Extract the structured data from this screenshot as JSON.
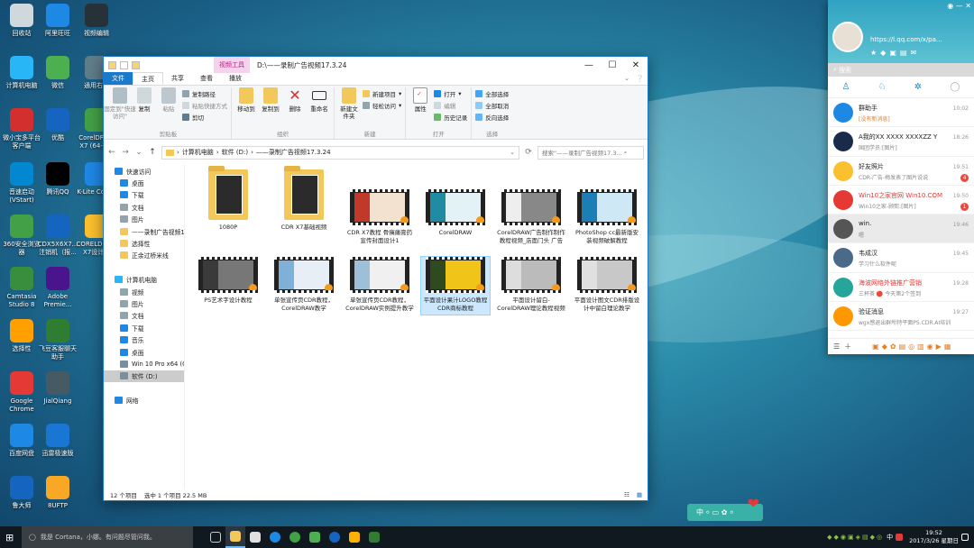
{
  "desktop_icons": [
    {
      "label": "回收站",
      "color": "#cfd8dc"
    },
    {
      "label": "阿里旺旺",
      "color": "#1e88e5"
    },
    {
      "label": "视频编辑",
      "color": "#263238"
    },
    {
      "label": "计算机电脑",
      "color": "#29b6f6"
    },
    {
      "label": "微信",
      "color": "#4caf50"
    },
    {
      "label": "通用右下",
      "color": "#607d8b"
    },
    {
      "label": "微小宝多平台客户端",
      "color": "#d32f2f"
    },
    {
      "label": "优酷",
      "color": "#1565c0"
    },
    {
      "label": "CorelDRAW X7 (64-Bit)",
      "color": "#43a047"
    },
    {
      "label": "音速启动(VStart)",
      "color": "#0288d1"
    },
    {
      "label": "腾讯QQ",
      "color": "#000"
    },
    {
      "label": "K-Lite Codec",
      "color": "#1e88e5"
    },
    {
      "label": "360安全浏览器",
      "color": "#43a047"
    },
    {
      "label": "CDX5X6X7...注销机（报...",
      "color": "#1565c0"
    },
    {
      "label": "CORELDRAW X7设计...",
      "color": "#fbc02d"
    },
    {
      "label": "Camtasia Studio 8",
      "color": "#388e3c"
    },
    {
      "label": "Adobe Premie...",
      "color": "#4a148c"
    },
    {
      "label": "选择性",
      "color": "#ffa000"
    },
    {
      "label": "飞豆客服聊天助手",
      "color": "#2e7d32"
    },
    {
      "label": "Google Chrome",
      "color": "#e53935"
    },
    {
      "label": "JialQiang",
      "color": "#455a64"
    },
    {
      "label": "百度网盘",
      "color": "#1e88e5"
    },
    {
      "label": "迅雷极速版",
      "color": "#1976d2"
    },
    {
      "label": "鲁大师",
      "color": "#1565c0"
    },
    {
      "label": "8UFTP",
      "color": "#f9a825"
    }
  ],
  "explorer": {
    "quick_access_toolbar": "",
    "context_tab": "视频工具",
    "title": "D:\\——录制广告视频17.3.24",
    "buttons": {
      "minimize": "—",
      "maximize": "☐",
      "close": "✕"
    },
    "tabs": [
      "文件",
      "主页",
      "共享",
      "查看",
      "播放"
    ],
    "ribbon": {
      "clipboard": {
        "name": "剪贴板",
        "pin": "固定到\"快速访问\"",
        "copy": "复制",
        "paste": "粘贴",
        "cut": "剪切",
        "copy_path": "复制路径",
        "paste_shortcut": "粘贴快捷方式"
      },
      "organize": {
        "name": "组织",
        "move_to": "移动到",
        "copy_to": "复制到",
        "delete": "删除",
        "rename": "重命名"
      },
      "new": {
        "name": "新建",
        "new_folder": "新建文件夹",
        "new_item": "新建项目",
        "easy_access": "轻松访问"
      },
      "open": {
        "name": "打开",
        "properties": "属性",
        "open": "打开",
        "edit": "编辑",
        "history": "历史记录"
      },
      "select": {
        "name": "选择",
        "select_all": "全部选择",
        "select_none": "全部取消",
        "invert": "反向选择"
      }
    },
    "address_path": [
      "计算机电脑",
      "软件 (D:)",
      "——录制广告视频17.3.24"
    ],
    "search_placeholder": "搜索\"——录制广告视频17.3...",
    "nav": [
      {
        "label": "快速访问",
        "icon": "star",
        "color": "#1e88e5",
        "indent": 0
      },
      {
        "label": "桌面",
        "icon": "desktop",
        "color": "#1e88e5",
        "indent": 1
      },
      {
        "label": "下载",
        "icon": "download",
        "color": "#1e88e5",
        "indent": 1
      },
      {
        "label": "文档",
        "icon": "doc",
        "color": "#90a4ae",
        "indent": 1
      },
      {
        "label": "图片",
        "icon": "pic",
        "color": "#90a4ae",
        "indent": 1
      },
      {
        "label": "——录制广告视频1",
        "icon": "folder",
        "color": "#f3c85b",
        "indent": 1
      },
      {
        "label": "选择性",
        "icon": "folder",
        "color": "#f3c85b",
        "indent": 1
      },
      {
        "label": "正余过桥米线",
        "icon": "folder",
        "color": "#f3c85b",
        "indent": 1
      },
      {
        "label": "",
        "icon": "",
        "color": "",
        "indent": 0
      },
      {
        "label": "计算机电脑",
        "icon": "pc",
        "color": "#29b6f6",
        "indent": 0
      },
      {
        "label": "视频",
        "icon": "video",
        "color": "#90a4ae",
        "indent": 1
      },
      {
        "label": "图片",
        "icon": "pic",
        "color": "#90a4ae",
        "indent": 1
      },
      {
        "label": "文档",
        "icon": "doc",
        "color": "#90a4ae",
        "indent": 1
      },
      {
        "label": "下载",
        "icon": "download",
        "color": "#1e88e5",
        "indent": 1
      },
      {
        "label": "音乐",
        "icon": "music",
        "color": "#1e88e5",
        "indent": 1
      },
      {
        "label": "桌面",
        "icon": "desktop",
        "color": "#1e88e5",
        "indent": 1
      },
      {
        "label": "Win 10 Pro x64 (C",
        "icon": "drive",
        "color": "#78909c",
        "indent": 1
      },
      {
        "label": "软件 (D:)",
        "icon": "drive",
        "color": "#78909c",
        "indent": 1,
        "selected": true
      },
      {
        "label": "",
        "icon": "",
        "color": "",
        "indent": 0
      },
      {
        "label": "网络",
        "icon": "network",
        "color": "#1e88e5",
        "indent": 0
      }
    ],
    "files": [
      {
        "name": "1080P",
        "type": "folder"
      },
      {
        "name": "CDR X7基础视频",
        "type": "folder"
      },
      {
        "name": "CDR X7教程 骨痍痛膏药宣传封面设计1",
        "type": "video",
        "c1": "#c0392b",
        "c2": "#f3e2d0"
      },
      {
        "name": "CorelDRAW",
        "type": "video",
        "c1": "#1f8ca3",
        "c2": "#e3f2f5"
      },
      {
        "name": "CorelDRAW广告制作制作教程视频_店面门头 广告",
        "type": "video",
        "c1": "#eeeeee",
        "c2": "#888"
      },
      {
        "name": "PhotoShop cc最新版安装视频破解教程",
        "type": "video",
        "c1": "#1b7fb5",
        "c2": "#cfe8f5"
      },
      {
        "name": "PS艺术字设计教程",
        "type": "video",
        "c1": "#3a3a3a",
        "c2": "#777"
      },
      {
        "name": "单张宣传页CDR教程，CorelDRAW教学",
        "type": "video",
        "c1": "#7fb0d8",
        "c2": "#e8eef5"
      },
      {
        "name": "单张宣传页CDR教程，CorelDRAW实例提升教学",
        "type": "video",
        "c1": "#9dbfd8",
        "c2": "#f0f0f0"
      },
      {
        "name": "平面设计果汁LOGO教程 CDR商标教程",
        "type": "video",
        "c1": "#2e4a1f",
        "c2": "#f0c419",
        "selected": true
      },
      {
        "name": "平面设计留白-CorelDRAW理论教程视频",
        "type": "video",
        "c1": "#ddd",
        "c2": "#bbb"
      },
      {
        "name": "平面设计图文CDR排版设计中留白理论教学",
        "type": "video",
        "c1": "#e0e0e0",
        "c2": "#c8c8c8"
      }
    ],
    "status": {
      "count": "12 个项目",
      "selection": "选中 1 个项目  22.5 MB"
    }
  },
  "qq": {
    "url": "https://l.qq.com/x/pa...",
    "search": "搜索",
    "chats": [
      {
        "name": "群助手",
        "msg": "[没有新消息]",
        "time": "10:02",
        "color": "#1e88e5",
        "red": false,
        "msgred": true
      },
      {
        "name": "A我的XX XXXX  XXXXZZ Y",
        "msg": "国团学员:[图片]",
        "time": "18:26",
        "color": "#1a2a4a",
        "red": false
      },
      {
        "name": "好友照片",
        "msg": "CDR-广告-梅发表了图片说说",
        "time": "19:51",
        "color": "#fbc02d",
        "badge": "4"
      },
      {
        "name": "Win10之家官网   Win10.COM",
        "msg": "Win10之家-顾熙:[图片]",
        "time": "19:50",
        "color": "#e53935",
        "badge": "1",
        "red": true
      },
      {
        "name": "win.",
        "msg": "嗯",
        "time": "19:46",
        "color": "#555",
        "hl": true
      },
      {
        "name": "韦成汉",
        "msg": "学习什么软件呢",
        "time": "19:45",
        "color": "#4a6a8a"
      },
      {
        "name": "海波网络外链推广营销",
        "msg": "三杯茶 🔴 今天第2个签到",
        "time": "19:28",
        "color": "#26a69a",
        "red": true
      },
      {
        "name": "验证消息",
        "msg": "wgx感退出群所特平面PS.CDR.AI培训",
        "time": "19:27",
        "color": "#ff9800"
      }
    ]
  },
  "taskbar": {
    "search": "我是 Cortana，小娜。有问题尽管问我。",
    "ime": "中",
    "time": "19:52",
    "date": "2017/3/26 星期日"
  },
  "imebar": {
    "label": "中 ⸰ ▭ ✿ ⸰"
  }
}
